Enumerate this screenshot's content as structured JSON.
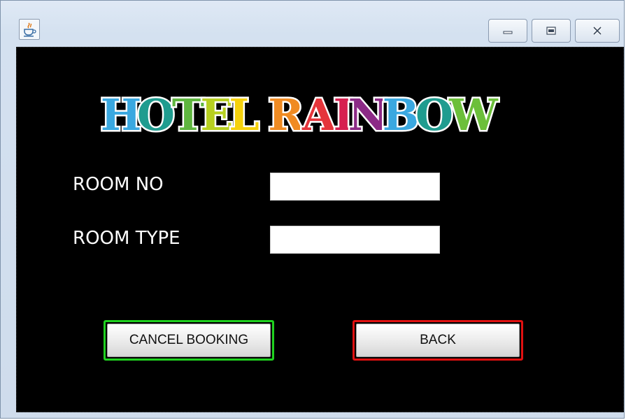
{
  "window": {
    "icon": "java-cup-icon",
    "controls": [
      "minimize-icon",
      "maximize-icon",
      "close-icon"
    ]
  },
  "logo": {
    "text": "HOTEL RAINBOW",
    "letters": [
      {
        "ch": "H",
        "color": "#3aa8e0"
      },
      {
        "ch": "O",
        "color": "#1f9c8f"
      },
      {
        "ch": "T",
        "color": "#5fb63f"
      },
      {
        "ch": "E",
        "color": "#b7d020"
      },
      {
        "ch": "L",
        "color": "#f5d10c"
      },
      {
        "ch": " ",
        "color": "#000000"
      },
      {
        "ch": "R",
        "color": "#f08b22"
      },
      {
        "ch": "A",
        "color": "#e5353b"
      },
      {
        "ch": "I",
        "color": "#d61f4f"
      },
      {
        "ch": "N",
        "color": "#8c2a86"
      },
      {
        "ch": "B",
        "color": "#3aa8e0"
      },
      {
        "ch": "O",
        "color": "#1f9c8f"
      },
      {
        "ch": "W",
        "color": "#6cbf3a"
      }
    ]
  },
  "form": {
    "room_no_label": "ROOM NO",
    "room_no_value": "",
    "room_type_label": "ROOM TYPE",
    "room_type_value": ""
  },
  "buttons": {
    "cancel_booking": "CANCEL BOOKING",
    "cancel_border": "#1fd11f",
    "back": "BACK",
    "back_border": "#e01010"
  }
}
